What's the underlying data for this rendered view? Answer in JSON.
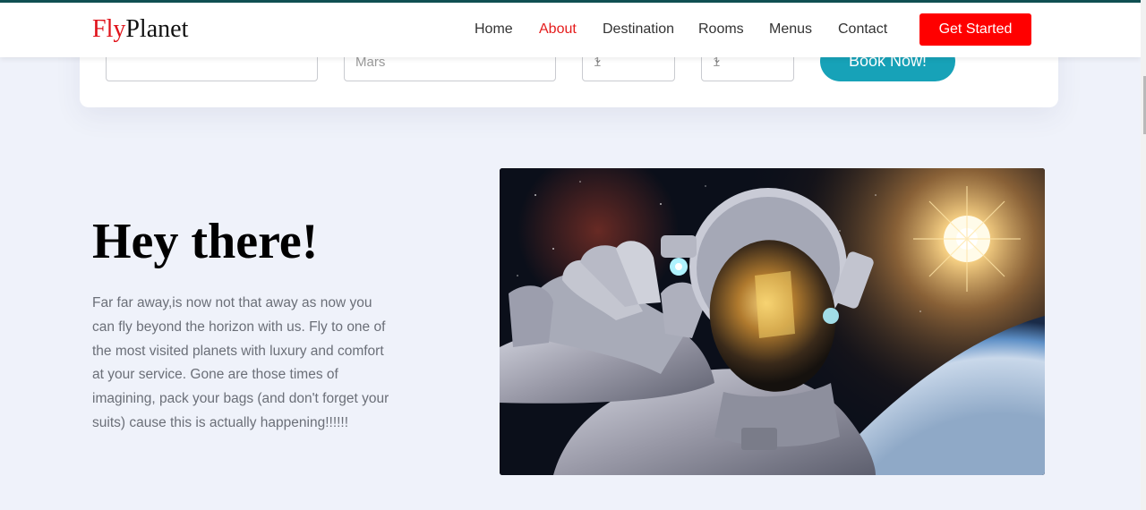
{
  "brand": {
    "part1": "Fly",
    "part2": "Planet"
  },
  "nav": {
    "items": [
      {
        "label": "Home"
      },
      {
        "label": "About"
      },
      {
        "label": "Destination"
      },
      {
        "label": "Rooms"
      },
      {
        "label": "Menus"
      },
      {
        "label": "Contact"
      }
    ],
    "active": "About",
    "cta_label": "Get Started"
  },
  "booking": {
    "destination_value": "Mars",
    "select1_value": "1",
    "select2_value": "1",
    "book_label": "Book Now!"
  },
  "about": {
    "heading": "Hey there!",
    "paragraph": "Far far away,is now not that away as now you can fly beyond the horizon with us. Fly to one of the most visited planets with luxury and comfort at your service. Gone are those times of imagining, pack your bags (and don't forget your suits) cause this is actually happening!!!!!!"
  },
  "colors": {
    "brand_accent": "#e0121a",
    "active_nav": "#e51c1c",
    "cta_bg": "#ff0000",
    "book_bg": "#17a2b8",
    "page_bg": "#eff2fa"
  }
}
